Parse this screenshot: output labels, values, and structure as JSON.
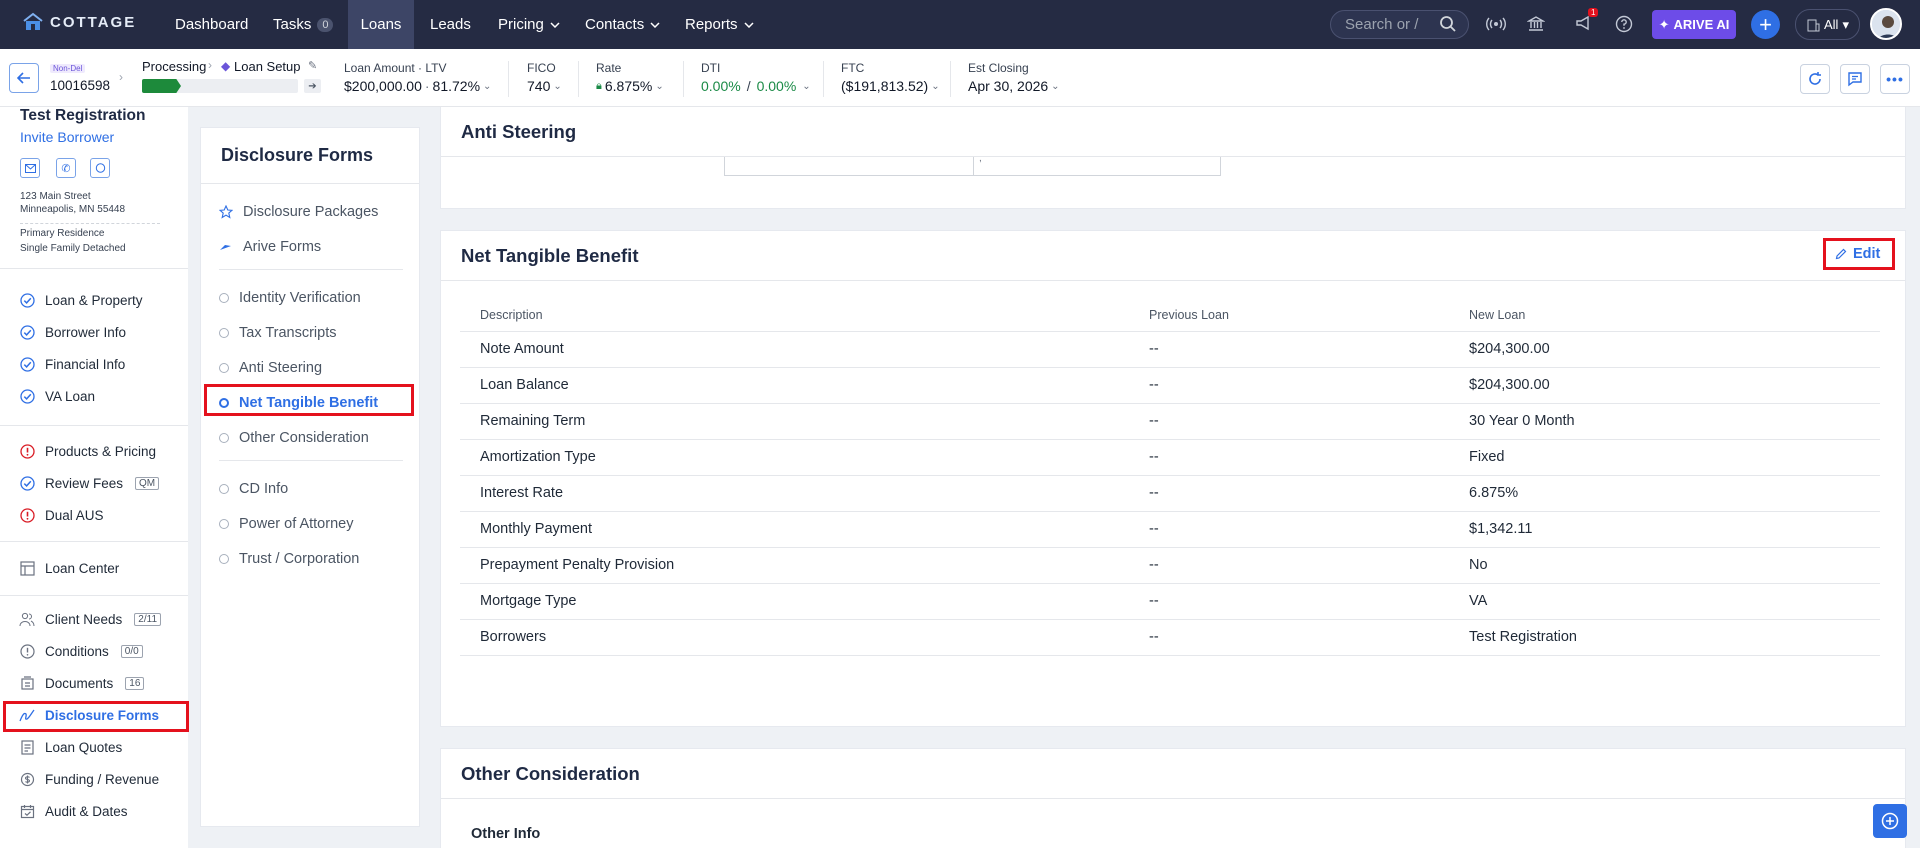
{
  "nav": {
    "brand": "COTTAGE",
    "links": [
      "Dashboard",
      "Tasks",
      "Loans",
      "Leads",
      "Pricing",
      "Contacts",
      "Reports"
    ],
    "tasks_count": "0",
    "search_placeholder": "Search or /",
    "notif_count": "1",
    "arive_ai": "ARIVE AI",
    "scope": "All"
  },
  "loanbar": {
    "status_tag": "Non-Del",
    "loan_number": "10016598",
    "stage": "Processing",
    "substage": "Loan Setup",
    "progress": 0.25,
    "loan_amount_label": "Loan Amount · LTV",
    "loan_amount": "$200,000.00",
    "ltv": "81.72%",
    "fico_label": "FICO",
    "fico": "740",
    "rate_label": "Rate",
    "rate": "6.875%",
    "dti_label": "DTI",
    "dti_front": "0.00%",
    "dti_sep": "/",
    "dti_back": "0.00%",
    "ftc_label": "FTC",
    "ftc": "($191,813.52)",
    "closing_label": "Est Closing",
    "closing": "Apr 30, 2026"
  },
  "borrower": {
    "name": "Test Registration",
    "invite": "Invite Borrower",
    "address1": "123 Main Street",
    "address2": "Minneapolis, MN 55448",
    "occupancy": "Primary Residence",
    "property_type": "Single Family Detached"
  },
  "sidebar": {
    "group1": [
      "Loan & Property",
      "Borrower Info",
      "Financial Info",
      "VA Loan"
    ],
    "group2": [
      "Products & Pricing",
      "Review Fees",
      "Dual AUS"
    ],
    "qm_badge": "QM",
    "loan_center": "Loan Center",
    "group3": [
      "Client Needs",
      "Conditions",
      "Documents",
      "Disclosure Forms",
      "Loan Quotes",
      "Funding / Revenue",
      "Audit & Dates"
    ],
    "client_needs_badge": "2/11",
    "conditions_badge": "0/0",
    "documents_badge": "16"
  },
  "forms_menu": {
    "title": "Disclosure Forms",
    "top": [
      "Disclosure Packages",
      "Arive Forms"
    ],
    "mid": [
      "Identity Verification",
      "Tax Transcripts",
      "Anti Steering",
      "Net Tangible Benefit",
      "Other Consideration"
    ],
    "bottom": [
      "CD Info",
      "Power of Attorney",
      "Trust / Corporation"
    ]
  },
  "anti_steering": {
    "title": "Anti Steering",
    "partial_cell": ","
  },
  "ntb": {
    "title": "Net Tangible Benefit",
    "edit": "Edit",
    "headers": [
      "Description",
      "Previous Loan",
      "New Loan"
    ],
    "rows": [
      [
        "Note Amount",
        "--",
        "$204,300.00"
      ],
      [
        "Loan Balance",
        "--",
        "$204,300.00"
      ],
      [
        "Remaining Term",
        "--",
        "30 Year 0 Month"
      ],
      [
        "Amortization Type",
        "--",
        "Fixed"
      ],
      [
        "Interest Rate",
        "--",
        "6.875%"
      ],
      [
        "Monthly Payment",
        "--",
        "$1,342.11"
      ],
      [
        "Prepayment Penalty Provision",
        "--",
        "No"
      ],
      [
        "Mortgage Type",
        "--",
        "VA"
      ],
      [
        "Borrowers",
        "--",
        "Test Registration"
      ]
    ]
  },
  "other": {
    "title": "Other Consideration",
    "subtitle": "Other Info"
  },
  "colors": {
    "nav_bg": "#252b43",
    "accent": "#2f6fe4",
    "highlight": "#e4111d",
    "success": "#1a8a46"
  }
}
